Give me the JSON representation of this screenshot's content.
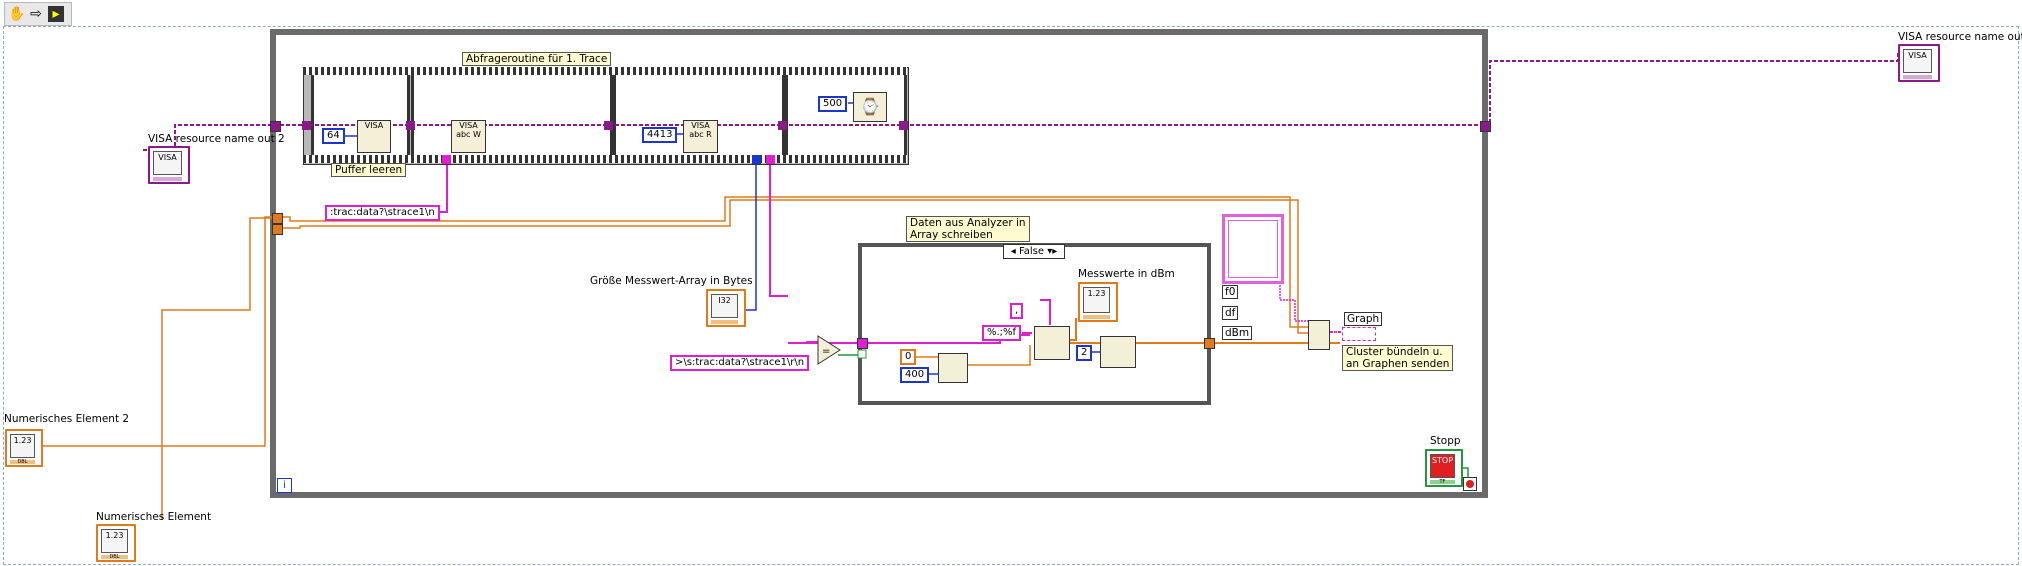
{
  "toolbar": {
    "icons": [
      "hand-icon",
      "arrow-icon",
      "run-icon"
    ]
  },
  "colors": {
    "int_wire": "#1a35d0",
    "dbl_wire": "#e07a1a",
    "str_wire": "#e020d0",
    "visa_wire": "#8a1a8a",
    "bool_wire": "#1f9a3a"
  },
  "labels": {
    "visa_out": "VISA resource name out",
    "visa_out2": "VISA resource name out 2",
    "num_el2": "Numerisches Element 2",
    "num_el": "Numerisches Element",
    "groesse": "Größe Messwert-Array in Bytes",
    "messwerte": "Messwerte in dBm",
    "graph": "Graph",
    "stopp": "Stopp"
  },
  "comments": {
    "abfrage": "Abfrageroutine für 1. Trace",
    "puffer": "Puffer leeren",
    "daten_line1": "Daten aus Analyzer in",
    "daten_line2": "Array schreiben",
    "cluster_line1": "Cluster bündeln u.",
    "cluster_line2": "an Graphen senden"
  },
  "constants": {
    "c64": "64",
    "c4413": "4413",
    "c500": "500",
    "c0": "0",
    "c400": "400",
    "c2": "2",
    "trac_str": ":trac:data?\\strace1\\n",
    "compare_str": ">\\s:trac:data?\\strace1\\r\\n",
    "format_str": "%.;%f",
    "sep_str": ","
  },
  "case": {
    "selector": "False"
  },
  "bundle_labels": [
    "f0",
    "df",
    "dBm"
  ],
  "terminals": {
    "visa": "VISA",
    "i32": "I32",
    "dbl": "DBL",
    "num": "1.23",
    "stop": "STOP",
    "tf": "TF"
  },
  "loop_index": "i",
  "nodes": {
    "visa_clear": "VISA",
    "visa_write": "VISA abc W",
    "visa_read": "VISA abc R",
    "wait": "⌚"
  }
}
